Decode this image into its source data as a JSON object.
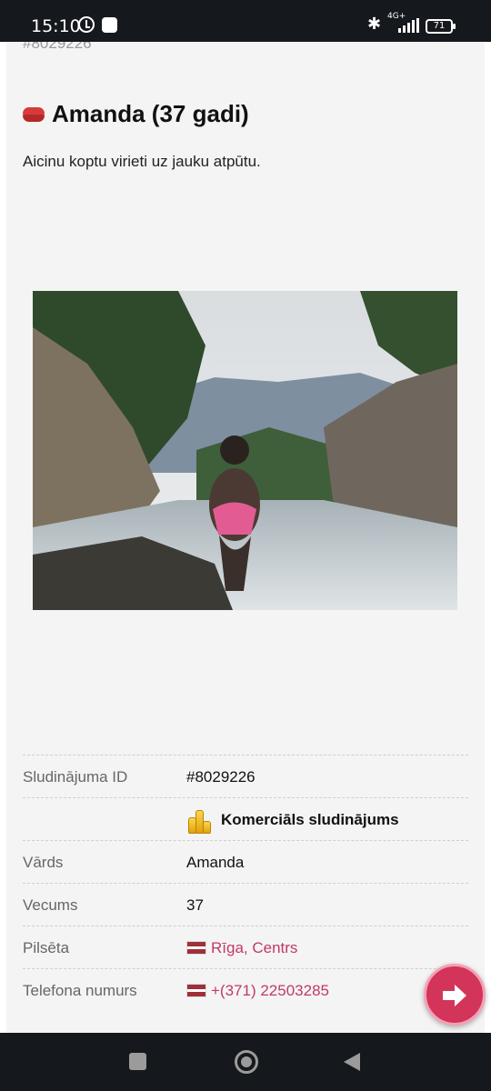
{
  "status_bar": {
    "time": "15:10",
    "network": "4G+",
    "battery": "71",
    "icons": [
      "alarm-icon",
      "notification-icon",
      "bluetooth-icon",
      "signal-icon",
      "battery-icon"
    ]
  },
  "listing": {
    "prev_id": "#8029226",
    "title": "Amanda (37 gadi)",
    "intro": "Aicinu koptu virieti uz jauku atpūtu."
  },
  "details": {
    "rows": [
      {
        "label": "Sludinājuma ID",
        "value": "#8029226"
      },
      {
        "label": "",
        "value": "Komerciāls sludinājums"
      },
      {
        "label": "Vārds",
        "value": "Amanda"
      },
      {
        "label": "Vecums",
        "value": "37"
      },
      {
        "label": "Pilsēta",
        "value": "Rīga, Centrs"
      },
      {
        "label": "Telefona numurs",
        "value": "+(371) 22503285"
      }
    ]
  },
  "colors": {
    "link": "#c0396b",
    "fab": "#d2345a",
    "card_bg": "#f4f4f4"
  }
}
